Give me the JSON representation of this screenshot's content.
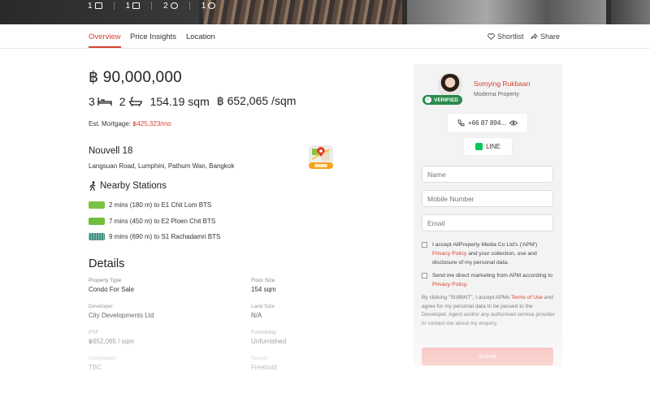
{
  "gallery": {
    "counts": [
      {
        "icon": "image-icon",
        "value": "1"
      },
      {
        "icon": "floorplan-icon",
        "value": "1"
      },
      {
        "icon": "video-icon",
        "value": "2"
      },
      {
        "icon": "virtual-tour-icon",
        "value": "1"
      }
    ]
  },
  "tabs": {
    "overview": "Overview",
    "price_insights": "Price Insights",
    "location": "Location"
  },
  "actions": {
    "shortlist": "Shortlist",
    "share": "Share"
  },
  "listing": {
    "price": "฿ 90,000,000",
    "bedrooms": "3",
    "bathrooms": "2",
    "area": "154.19 sqm",
    "price_per_sqm": "฿ 652,065 /sqm",
    "mortgage_label": "Est. Mortgage:",
    "mortgage_value": "฿425,323/mo",
    "project_name": "Nouvell 18",
    "address": "Langsuan Road, Lumphini, Pathum Wan, Bangkok"
  },
  "nearby": {
    "title": "Nearby Stations",
    "stations": [
      {
        "text": "2 mins (180 m) to E1 Chit Lom BTS",
        "color": "#7bc243"
      },
      {
        "text": "7 mins (450 m) to E2 Ploen Chit BTS",
        "color": "#6fbe3a"
      },
      {
        "text": "9 mins (690 m) to S1 Rachadamri BTS",
        "color": "#3e8e7e"
      }
    ]
  },
  "details": {
    "title": "Details",
    "items": [
      {
        "label": "Property Type",
        "value": "Condo For Sale"
      },
      {
        "label": "Floor Size",
        "value": "154 sqm"
      },
      {
        "label": "Developer",
        "value": "City Developments Ltd"
      },
      {
        "label": "Land Size",
        "value": "N/A"
      },
      {
        "label": "PSF",
        "value": "฿652,065 / sqm"
      },
      {
        "label": "Furnishing",
        "value": "Unfurnished"
      },
      {
        "label": "Completion",
        "value": "TBC"
      },
      {
        "label": "Tenure",
        "value": "Freehold"
      }
    ]
  },
  "agent": {
    "name": "Somying Rukbaan",
    "agency": "Moderna Property",
    "verified": "VERIFIED",
    "phone": "+66 87 894...",
    "line_label": "LINE"
  },
  "form": {
    "name_placeholder": "Name",
    "mobile_placeholder": "Mobile Number",
    "email_placeholder": "Email",
    "consent1_text": "I accept AllProperty Media Co Ltd's ('APM')",
    "consent1_link": "Privacy Policy",
    "consent1_tail": "and your collection, use and disclosure of my personal data.",
    "consent2_text": "Send me direct marketing from APM according to",
    "consent2_link": "Privacy Policy.",
    "terms_prefix": "By clicking \"SUBMIT\", I accept APMs",
    "terms_link": "Terms of Use",
    "terms_tail": "and agree for my personal data to be passed to the Developer, Agent and/or any authorised service provider to contact me about my enquiry.",
    "submit_label": "Submit"
  },
  "colors": {
    "accent": "#d8412f",
    "verified": "#2b8a4c",
    "line": "#06c755"
  }
}
